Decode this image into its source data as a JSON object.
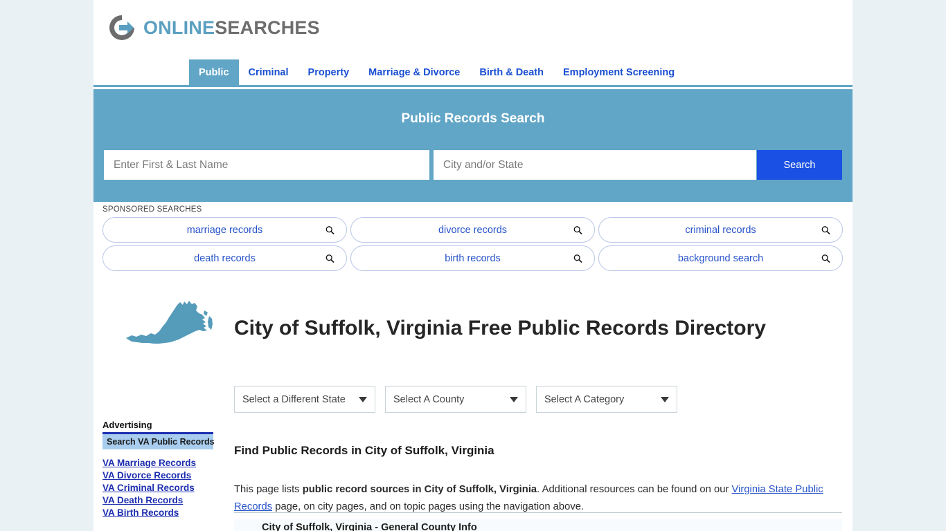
{
  "brand": {
    "name_part1": "ONLINE",
    "name_part2": "SEARCHES",
    "logo_icon": "circle-arrow-icon",
    "accent_blue": "#5a9fc0",
    "accent_gray": "#6d6d6d"
  },
  "nav": {
    "items": [
      {
        "label": "Public",
        "active": true
      },
      {
        "label": "Criminal",
        "active": false
      },
      {
        "label": "Property",
        "active": false
      },
      {
        "label": "Marriage & Divorce",
        "active": false
      },
      {
        "label": "Birth & Death",
        "active": false
      },
      {
        "label": "Employment Screening",
        "active": false
      }
    ]
  },
  "search": {
    "title": "Public Records Search",
    "name_placeholder": "Enter First & Last Name",
    "name_value": "",
    "city_placeholder": "City and/or State",
    "city_value": "",
    "button_label": "Search",
    "band_color": "#62a6c7",
    "button_color": "#1a50e3"
  },
  "sponsored": {
    "label": "SPONSORED SEARCHES",
    "items": [
      {
        "label": "marriage records",
        "icon": "magnifier-icon"
      },
      {
        "label": "divorce records",
        "icon": "magnifier-icon"
      },
      {
        "label": "criminal records",
        "icon": "magnifier-icon"
      },
      {
        "label": "death records",
        "icon": "magnifier-icon"
      },
      {
        "label": "birth records",
        "icon": "magnifier-icon"
      },
      {
        "label": "background search",
        "icon": "magnifier-icon"
      }
    ]
  },
  "main": {
    "state_map_icon": "virginia-state-map-icon",
    "state_map_color": "#559bba",
    "page_title": "City of Suffolk, Virginia Free Public Records Directory",
    "selects": [
      {
        "label": "Select a Different State"
      },
      {
        "label": "Select A County"
      },
      {
        "label": "Select A Category"
      }
    ],
    "section_heading": "Find Public Records in City of Suffolk, Virginia",
    "paragraph": {
      "text_1": "This page lists ",
      "bold_1": "public record sources in City of Suffolk, Virginia",
      "text_2": ". Additional resources can be found on our ",
      "link_1": "Virginia State Public Records",
      "text_3": " page, on city pages, and on topic pages using the navigation above."
    },
    "table_header": "City of Suffolk, Virginia - General County Info"
  },
  "sidebar_ad": {
    "title": "Advertising",
    "banner_label": "Search VA Public Records",
    "links": [
      {
        "label": "VA Marriage Records"
      },
      {
        "label": "VA Divorce Records"
      },
      {
        "label": "VA Criminal Records"
      },
      {
        "label": "VA Death Records"
      },
      {
        "label": "VA Birth Records"
      }
    ]
  }
}
